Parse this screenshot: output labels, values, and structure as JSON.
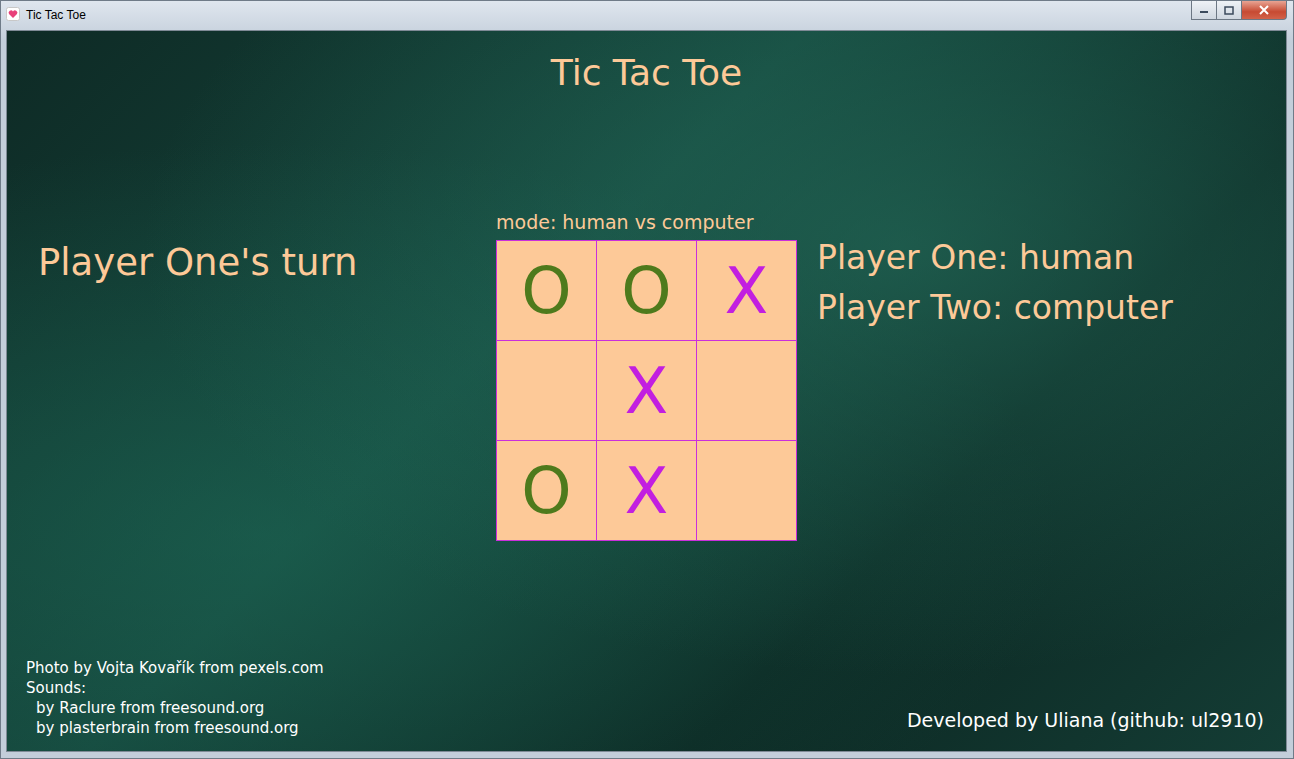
{
  "window": {
    "title": "Tic Tac Toe"
  },
  "heading": "Tic Tac Toe",
  "status": "Player One's turn",
  "mode": "mode: human vs computer",
  "board": [
    [
      {
        "mark": "O",
        "color": "#4e7a1c"
      },
      {
        "mark": "O",
        "color": "#4e7a1c"
      },
      {
        "mark": "X",
        "color": "#c21fe0"
      }
    ],
    [
      {
        "mark": "",
        "color": "#fdc998"
      },
      {
        "mark": "X",
        "color": "#c21fe0"
      },
      {
        "mark": "",
        "color": "#fdc998"
      }
    ],
    [
      {
        "mark": "O",
        "color": "#4e7a1c"
      },
      {
        "mark": "X",
        "color": "#c21fe0"
      },
      {
        "mark": "",
        "color": "#fdc998"
      }
    ]
  ],
  "players": [
    "Player One: human",
    "Player Two: computer"
  ],
  "credits": [
    {
      "text": "Photo by Vojta Kovařík from pexels.com",
      "indent": false
    },
    {
      "text": "Sounds:",
      "indent": false
    },
    {
      "text": "by Raclure from freesound.org",
      "indent": true
    },
    {
      "text": "by plasterbrain from freesound.org",
      "indent": true
    }
  ],
  "developer": "Developed by Uliana (github: ul2910)"
}
